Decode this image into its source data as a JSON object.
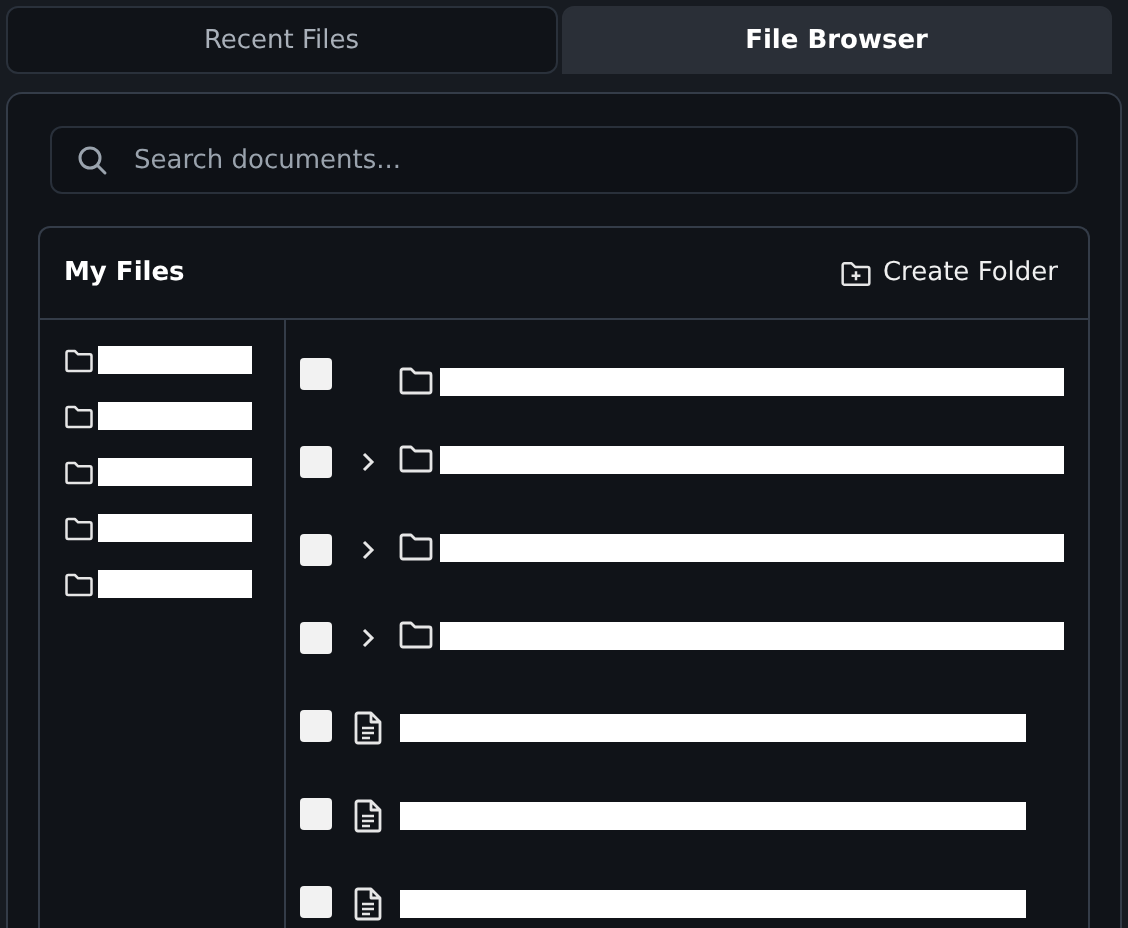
{
  "tabs": [
    {
      "label": "Recent Files",
      "selected": false
    },
    {
      "label": "File Browser",
      "selected": true
    }
  ],
  "search": {
    "placeholder": "Search documents..."
  },
  "panel": {
    "title": "My Files",
    "create_button": "Create Folder"
  },
  "sidebar": {
    "items": [
      {
        "kind": "folder"
      },
      {
        "kind": "folder"
      },
      {
        "kind": "folder"
      },
      {
        "kind": "folder"
      },
      {
        "kind": "folder"
      }
    ]
  },
  "files": [
    {
      "kind": "folder",
      "expandable": false,
      "checked": false
    },
    {
      "kind": "folder",
      "expandable": true,
      "checked": false
    },
    {
      "kind": "folder",
      "expandable": true,
      "checked": false
    },
    {
      "kind": "folder",
      "expandable": true,
      "checked": false
    },
    {
      "kind": "file",
      "checked": false
    },
    {
      "kind": "file",
      "checked": false
    },
    {
      "kind": "file",
      "checked": false
    }
  ]
}
